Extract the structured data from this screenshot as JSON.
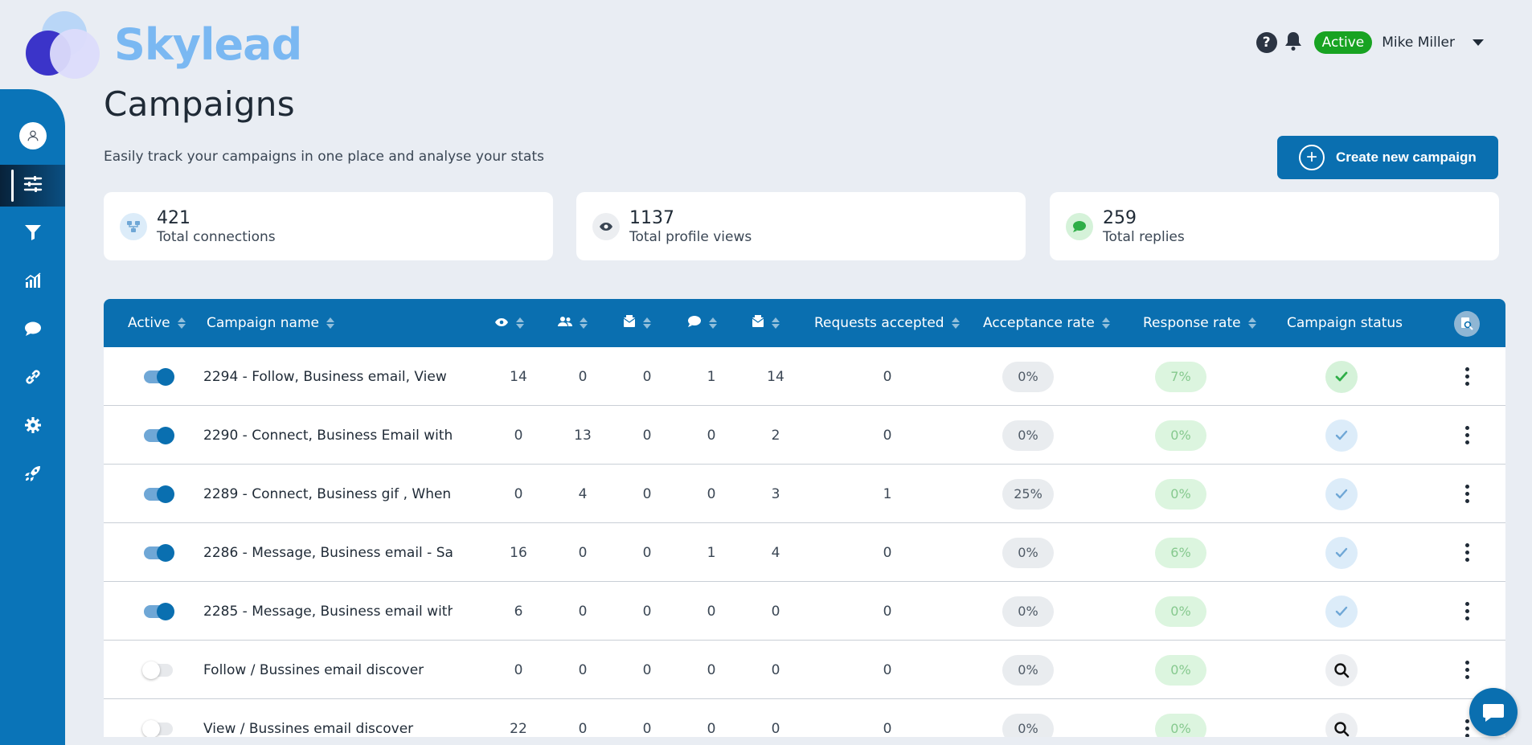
{
  "brand": {
    "name": "Skylead"
  },
  "header": {
    "status_badge": "Active",
    "user_name": "Mike Miller"
  },
  "page": {
    "title": "Campaigns",
    "subtitle": "Easily track your campaigns in one place and analyse your stats",
    "create_button": "Create new campaign"
  },
  "sidebar": {
    "items": [
      {
        "icon": "user-icon"
      },
      {
        "icon": "sliders-icon",
        "active": true
      },
      {
        "icon": "funnel-icon"
      },
      {
        "icon": "bar-chart-icon"
      },
      {
        "icon": "chat-bubble-icon"
      },
      {
        "icon": "link-icon"
      },
      {
        "icon": "gear-icon"
      },
      {
        "icon": "rocket-icon"
      }
    ]
  },
  "stats": [
    {
      "value": "421",
      "label": "Total connections",
      "icon": "connections-icon"
    },
    {
      "value": "1137",
      "label": "Total profile views",
      "icon": "eye-icon"
    },
    {
      "value": "259",
      "label": "Total replies",
      "icon": "chat-bubble-icon"
    }
  ],
  "table": {
    "headers": {
      "active": "Active",
      "name": "Campaign name",
      "views_icon": "eye-icon",
      "connections_icon": "users-icon",
      "emails_icon": "envelope-icon",
      "replies_icon": "chat-icon",
      "emails2_icon": "mail-icon",
      "requests": "Requests accepted",
      "acceptance": "Acceptance rate",
      "response": "Response rate",
      "status": "Campaign status"
    },
    "rows": [
      {
        "active": true,
        "name": "2294 - Follow, Business email, View",
        "c1": "14",
        "c2": "0",
        "c3": "0",
        "c4": "1",
        "c5": "14",
        "requests": "0",
        "acceptance": "0%",
        "response": "7%",
        "status": "completed"
      },
      {
        "active": true,
        "name": "2290 - Connect, Business Email with...",
        "c1": "0",
        "c2": "13",
        "c3": "0",
        "c4": "0",
        "c5": "2",
        "requests": "0",
        "acceptance": "0%",
        "response": "0%",
        "status": "running"
      },
      {
        "active": true,
        "name": "2289 - Connect, Business gif , When...",
        "c1": "0",
        "c2": "4",
        "c3": "0",
        "c4": "0",
        "c5": "3",
        "requests": "1",
        "acceptance": "25%",
        "response": "0%",
        "status": "running"
      },
      {
        "active": true,
        "name": "2286 - Message, Business email - Sa...",
        "c1": "16",
        "c2": "0",
        "c3": "0",
        "c4": "1",
        "c5": "4",
        "requests": "0",
        "acceptance": "0%",
        "response": "6%",
        "status": "running"
      },
      {
        "active": true,
        "name": "2285 - Message, Business email with...",
        "c1": "6",
        "c2": "0",
        "c3": "0",
        "c4": "0",
        "c5": "0",
        "requests": "0",
        "acceptance": "0%",
        "response": "0%",
        "status": "running"
      },
      {
        "active": false,
        "name": "Follow / Bussines email discover",
        "c1": "0",
        "c2": "0",
        "c3": "0",
        "c4": "0",
        "c5": "0",
        "requests": "0",
        "acceptance": "0%",
        "response": "0%",
        "status": "discover"
      },
      {
        "active": false,
        "name": "View / Bussines email discover",
        "c1": "22",
        "c2": "0",
        "c3": "0",
        "c4": "0",
        "c5": "0",
        "requests": "0",
        "acceptance": "0%",
        "response": "0%",
        "status": "discover"
      }
    ]
  },
  "colors": {
    "primary": "#0a6fb0",
    "sidebar": "#0a74b8",
    "active_green": "#18a322",
    "logo_text": "#7ab8f2"
  }
}
